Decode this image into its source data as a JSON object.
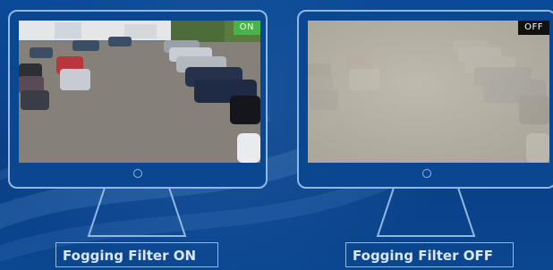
{
  "panels": [
    {
      "side": "left",
      "badge": "ON",
      "caption": "Fogging Filter ON"
    },
    {
      "side": "right",
      "badge": "OFF",
      "caption": "Fogging Filter OFF"
    }
  ],
  "colors": {
    "background": "#0a3f86",
    "outline": "#8fb8e2",
    "badge_on": "#47b44a",
    "badge_off": "#111111"
  }
}
